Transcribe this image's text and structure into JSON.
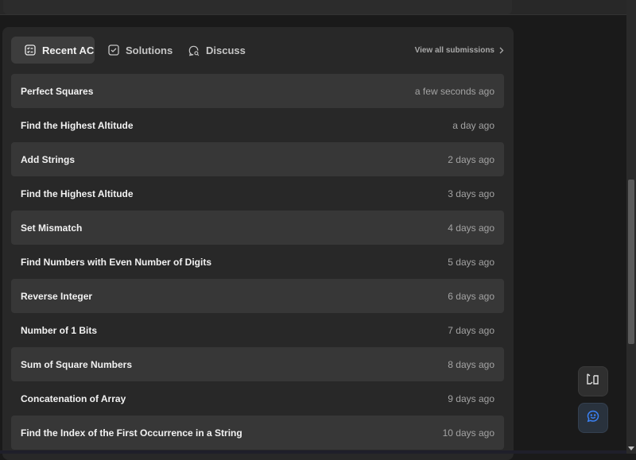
{
  "tabs": [
    {
      "label": "Recent AC",
      "icon": "list-check-icon",
      "active": true
    },
    {
      "label": "Solutions",
      "icon": "checkbox-icon",
      "active": false
    },
    {
      "label": "Discuss",
      "icon": "chat-search-icon",
      "active": false
    }
  ],
  "view_all_label": "View all submissions",
  "submissions": [
    {
      "title": "Perfect Squares",
      "time": "a few seconds ago"
    },
    {
      "title": "Find the Highest Altitude",
      "time": "a day ago"
    },
    {
      "title": "Add Strings",
      "time": "2 days ago"
    },
    {
      "title": "Find the Highest Altitude",
      "time": "3 days ago"
    },
    {
      "title": "Set Mismatch",
      "time": "4 days ago"
    },
    {
      "title": "Find Numbers with Even Number of Digits",
      "time": "5 days ago"
    },
    {
      "title": "Reverse Integer",
      "time": "6 days ago"
    },
    {
      "title": "Number of 1 Bits",
      "time": "7 days ago"
    },
    {
      "title": "Sum of Square Numbers",
      "time": "8 days ago"
    },
    {
      "title": "Concatenation of Array",
      "time": "9 days ago"
    },
    {
      "title": "Find the Index of the First Occurrence in a String",
      "time": "10 days ago"
    }
  ],
  "floating_buttons": [
    {
      "icon": "switch-layout-icon"
    },
    {
      "icon": "feedback-chat-icon"
    }
  ],
  "colors": {
    "background": "#1a1a1a",
    "panel": "#282828",
    "row_shaded": "#373737",
    "active_tab": "#3d3d3d",
    "accent_blue": "#3b82f6"
  }
}
